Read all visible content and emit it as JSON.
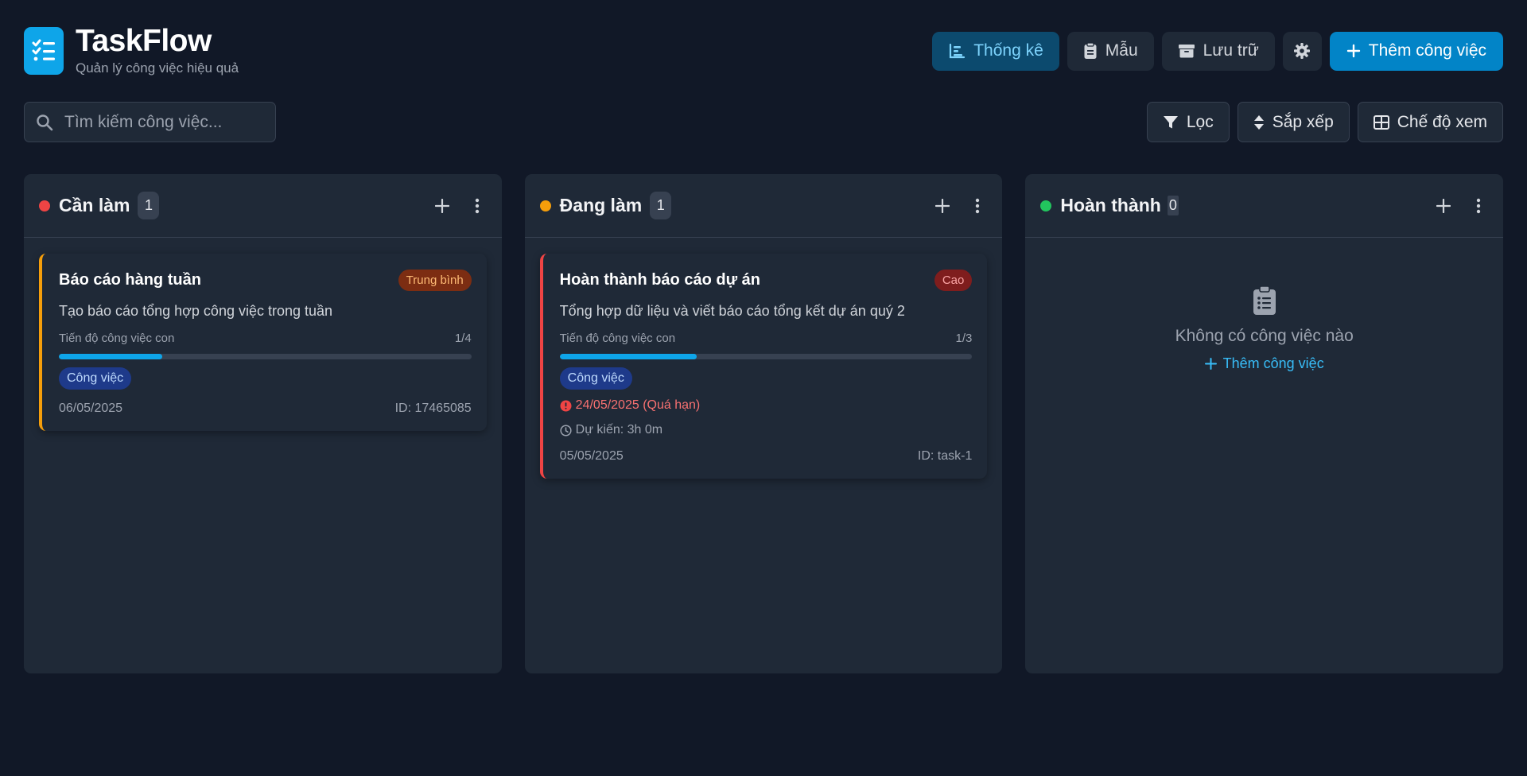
{
  "app": {
    "title": "TaskFlow",
    "subtitle": "Quản lý công việc hiệu quả"
  },
  "header": {
    "stats_label": "Thống kê",
    "templates_label": "Mẫu",
    "archive_label": "Lưu trữ",
    "add_task_label": "Thêm công việc"
  },
  "search": {
    "placeholder": "Tìm kiếm công việc...",
    "value": ""
  },
  "toolbar": {
    "filter_label": "Lọc",
    "sort_label": "Sắp xếp",
    "view_label": "Chế độ xem"
  },
  "columns": [
    {
      "title": "Cần làm",
      "count": "1",
      "color": "#ef4444",
      "cards": [
        {
          "title": "Báo cáo hàng tuần",
          "priority": "Trung bình",
          "description": "Tạo báo cáo tổng hợp công việc trong tuần",
          "progress_label": "Tiến độ công việc con",
          "progress_text": "1/4",
          "progress_fraction": 0.25,
          "tag": "Công việc",
          "date": "06/05/2025",
          "id": "ID: 17465085"
        }
      ]
    },
    {
      "title": "Đang làm",
      "count": "1",
      "color": "#f59e0b",
      "cards": [
        {
          "title": "Hoàn thành báo cáo dự án",
          "priority": "Cao",
          "description": "Tổng hợp dữ liệu và viết báo cáo tổng kết dự án quý 2",
          "progress_label": "Tiến độ công việc con",
          "progress_text": "1/3",
          "progress_fraction": 0.333,
          "tag": "Công việc",
          "due": "24/05/2025 (Quá hạn)",
          "estimate": "Dự kiến: 3h 0m",
          "date": "05/05/2025",
          "id": "ID: task-1"
        }
      ]
    },
    {
      "title": "Hoàn thành",
      "count": "0",
      "color": "#22c55e",
      "empty_text": "Không có công việc nào",
      "empty_add": "Thêm công việc"
    }
  ]
}
